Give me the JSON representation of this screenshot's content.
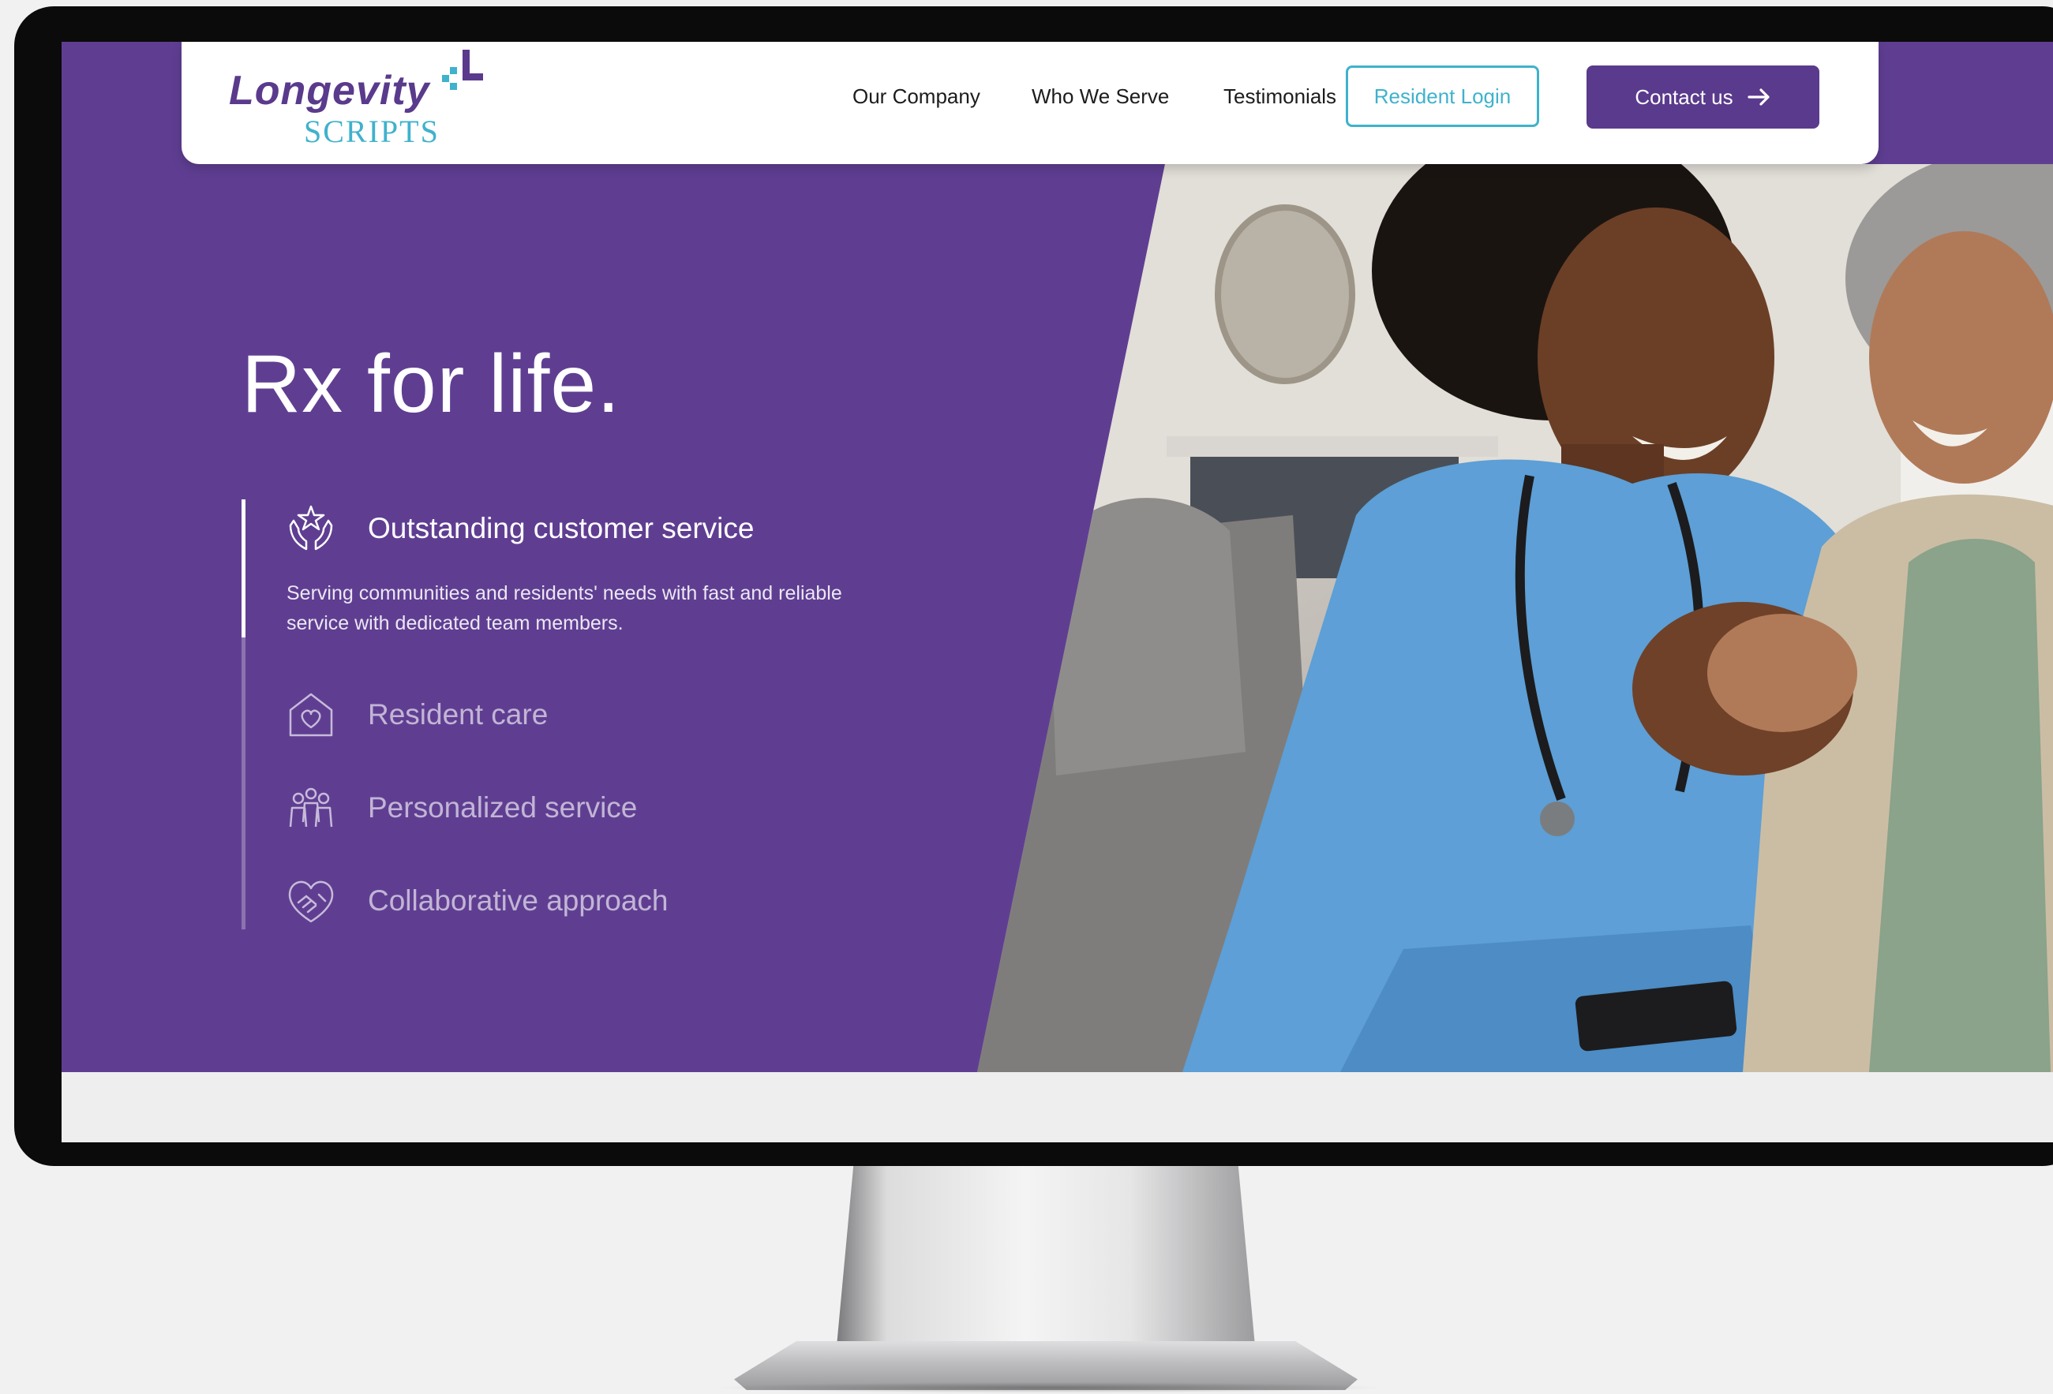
{
  "brand": {
    "name_main": "Longevity",
    "name_sub": "SCRIPTS",
    "color_primary": "#5a3a8c",
    "color_accent": "#3fb2cc"
  },
  "nav": {
    "links": [
      "Our Company",
      "Who We Serve",
      "Testimonials"
    ],
    "login_label": "Resident Login",
    "contact_label": "Contact us"
  },
  "hero": {
    "headline": "Rx for life.",
    "features": [
      {
        "label": "Outstanding customer service",
        "icon": "hands-star-icon",
        "active": true
      },
      {
        "label": "Resident care",
        "icon": "house-heart-icon",
        "active": false
      },
      {
        "label": "Personalized service",
        "icon": "people-group-icon",
        "active": false
      },
      {
        "label": "Collaborative approach",
        "icon": "heart-handshake-icon",
        "active": false
      }
    ],
    "active_description": "Serving communities and residents' needs with fast and reliable service with dedicated team members."
  }
}
